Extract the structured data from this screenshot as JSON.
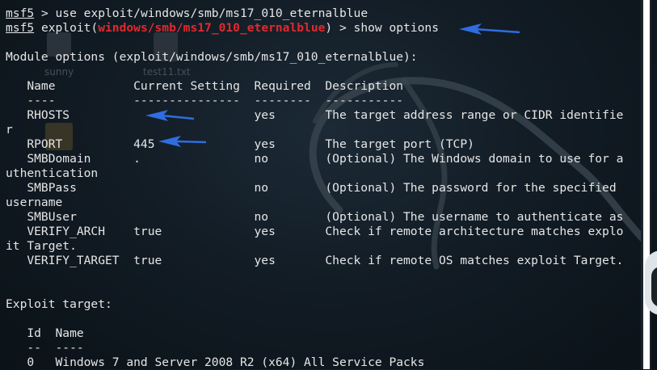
{
  "desktop": {
    "icon_sunny_label": "sunny",
    "icon_file_label": "test11.txt"
  },
  "terminal": {
    "line1_prompt": "msf5",
    "line1_cmd": " > use exploit/windows/smb/ms17_010_eternalblue",
    "line2_prompt": "msf5",
    "line2_pre": " exploit(",
    "line2_module": "windows/smb/ms17_010_eternalblue",
    "line2_post": ") > show options",
    "module_heading": "Module options (exploit/windows/smb/ms17_010_eternalblue):",
    "options_header": "   Name           Current Setting  Required  Description",
    "options_rule": "   ----           ---------------  --------  -----------",
    "options_rows": [
      "   RHOSTS                          yes       The target address range or CIDR identifie",
      "r",
      "   RPORT          445              yes       The target port (TCP)",
      "   SMBDomain      .                no        (Optional) The Windows domain to use for a",
      "uthentication",
      "   SMBPass                         no        (Optional) The password for the specified ",
      "username",
      "   SMBUser                         no        (Optional) The username to authenticate as",
      "   VERIFY_ARCH    true             yes       Check if remote architecture matches explo",
      "it Target.",
      "   VERIFY_TARGET  true             yes       Check if remote OS matches exploit Target."
    ],
    "target_heading": "Exploit target:",
    "target_header": "   Id  Name",
    "target_rule": "   --  ----",
    "target_row": "   0   Windows 7 and Server 2008 R2 (x64) All Service Packs"
  },
  "colors": {
    "module_red": "#e0292e",
    "arrow_blue": "#2f6de0"
  }
}
